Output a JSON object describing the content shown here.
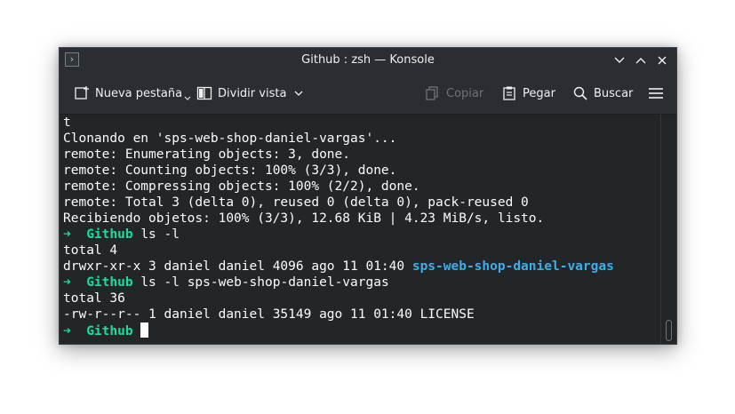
{
  "window": {
    "title": "Github : zsh — Konsole"
  },
  "toolbar": {
    "new_tab_label": "Nueva pestaña",
    "split_view_label": "Dividir vista",
    "copy_label": "Copiar",
    "paste_label": "Pegar",
    "search_label": "Buscar"
  },
  "terminal": {
    "lines": [
      "t",
      "Clonando en 'sps-web-shop-daniel-vargas'...",
      "remote: Enumerating objects: 3, done.",
      "remote: Counting objects: 100% (3/3), done.",
      "remote: Compressing objects: 100% (2/2), done.",
      "remote: Total 3 (delta 0), reused 0 (delta 0), pack-reused 0",
      "Recibiendo objetos: 100% (3/3), 12.68 KiB | 4.23 MiB/s, listo."
    ],
    "prompt_arrow": "➜",
    "prompt_dir": "Github",
    "cmd1": "ls -l",
    "out1_total": "total 4",
    "out1_row_prefix": "drwxr-xr-x 3 daniel daniel 4096 ago 11 01:40",
    "out1_row_dir": "sps-web-shop-daniel-vargas",
    "cmd2": "ls -l sps-web-shop-daniel-vargas",
    "out2_total": "total 36",
    "out2_row": "-rw-r--r-- 1 daniel daniel 35149 ago 11 01:40 LICENSE"
  },
  "colors": {
    "background": "#232629",
    "prompt_green": "#1cdc9a",
    "directory_blue": "#3daee9",
    "text": "#fcfcfc"
  }
}
